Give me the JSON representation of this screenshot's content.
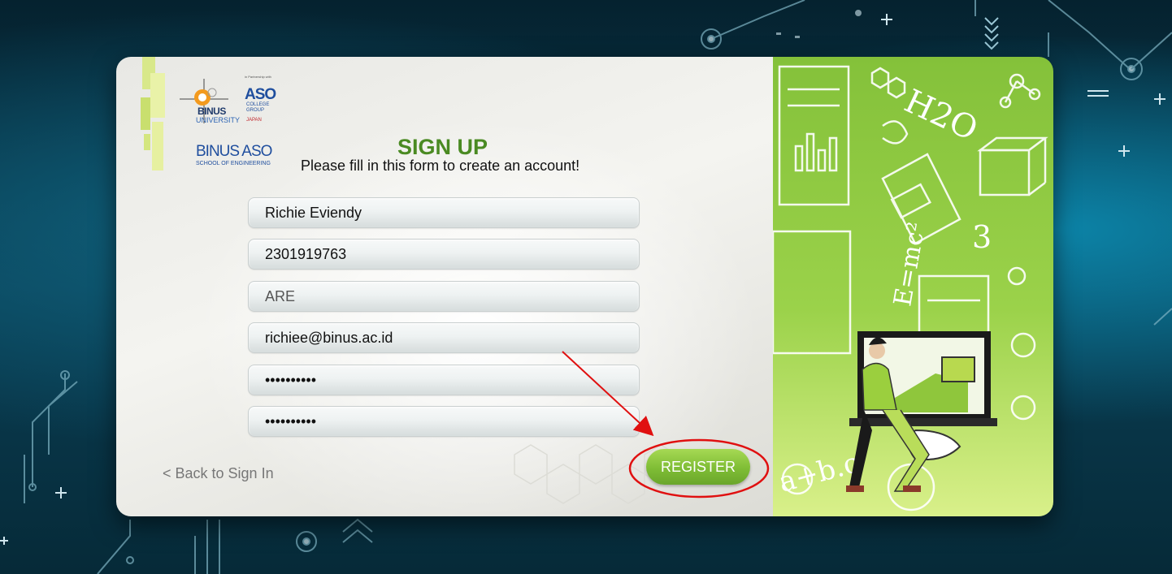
{
  "brand": {
    "binus": "BINUS",
    "binus_sub": "UNIVERSITY",
    "aso_partner": "in Partnership with",
    "aso": "ASO",
    "aso_group": "COLLEGE GROUP",
    "aso_country": "JAPAN",
    "school_line1": "BINUS ASO",
    "school_line2": "SCHOOL OF ENGINEERING"
  },
  "form": {
    "title": "SIGN UP",
    "subtitle": "Please fill in this form to create an account!",
    "fields": [
      {
        "value": "Richie Eviendy",
        "type": "text"
      },
      {
        "value": "2301919763",
        "type": "text"
      },
      {
        "value": "ARE",
        "type": "text"
      },
      {
        "value": "richiee@binus.ac.id",
        "type": "email"
      },
      {
        "value": "password12",
        "type": "password"
      },
      {
        "value": "password12",
        "type": "password"
      }
    ],
    "back_link": "< Back to Sign In",
    "register_label": "REGISTER"
  },
  "illustration": {
    "formula_h2o": "H2O",
    "formula_emc2": "E=mc²",
    "number_3": "3",
    "abc": "a+b.c"
  },
  "colors": {
    "accent_green": "#4a8a22",
    "button_green": "#7fbd35",
    "annotation_red": "#e01010"
  }
}
